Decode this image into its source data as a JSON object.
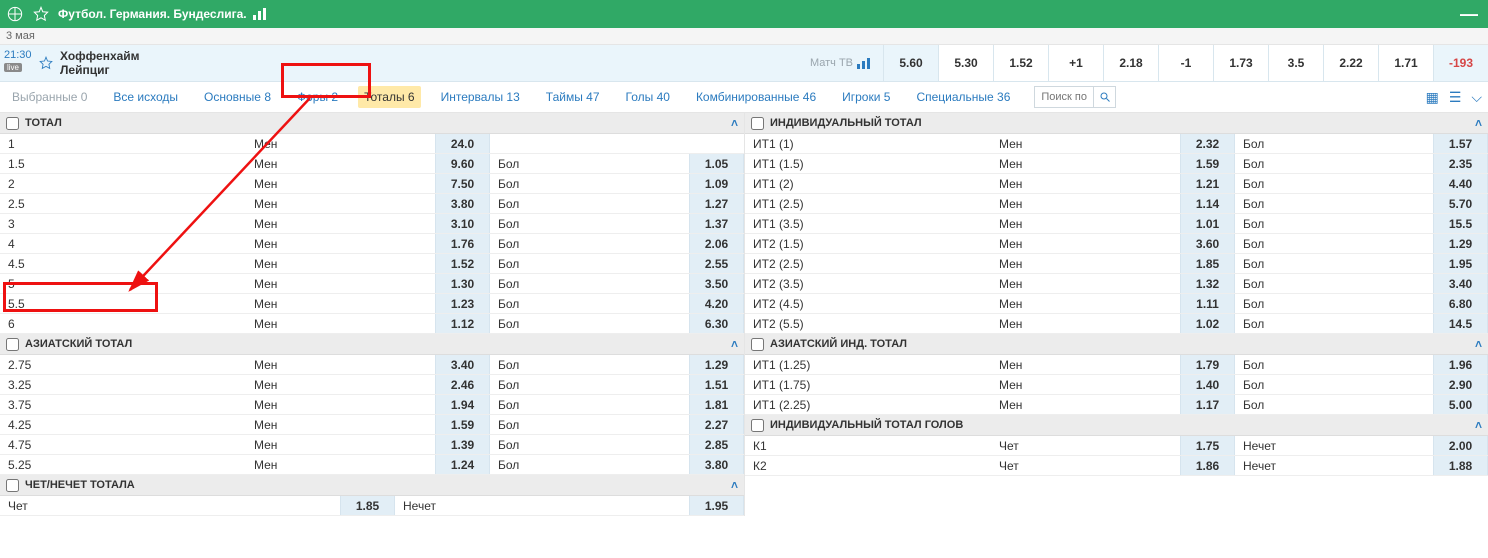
{
  "topbar": {
    "title": "Футбол. Германия. Бундеслига."
  },
  "date": "3 мая",
  "match": {
    "time": "21:30",
    "live": "live",
    "team1": "Хоффенхайм",
    "team2": "Лейпциг",
    "chartlabel": "Матч ТВ",
    "odds": [
      {
        "v": "5.60",
        "hl": true
      },
      {
        "v": "5.30"
      },
      {
        "v": "1.52"
      },
      {
        "v": "+1"
      },
      {
        "v": "2.18"
      },
      {
        "v": "-1"
      },
      {
        "v": "1.73"
      },
      {
        "v": "3.5"
      },
      {
        "v": "2.22"
      },
      {
        "v": "1.71"
      },
      {
        "v": "-193",
        "neg": true,
        "hl": true
      }
    ]
  },
  "tabs": {
    "left": [
      {
        "label": "Выбранные 0",
        "muted": true
      },
      {
        "label": "Все исходы"
      },
      {
        "label": "Основные 8"
      },
      {
        "label": "Форы 2"
      },
      {
        "label": "Тоталы 6",
        "active": true
      },
      {
        "label": "Интервалы 13"
      },
      {
        "label": "Таймы 47"
      },
      {
        "label": "Голы 40"
      },
      {
        "label": "Комбинированные 46"
      },
      {
        "label": "Игроки 5"
      }
    ],
    "right": [
      {
        "label": "Специальные 36"
      }
    ],
    "search_placeholder": "Поиск по"
  },
  "sections": {
    "total": {
      "title": "ТОТАЛ",
      "rows": [
        {
          "l": "1",
          "s1": "Мен",
          "o1": "24.0",
          "s2": "",
          "o2": ""
        },
        {
          "l": "1.5",
          "s1": "Мен",
          "o1": "9.60",
          "s2": "Бол",
          "o2": "1.05"
        },
        {
          "l": "2",
          "s1": "Мен",
          "o1": "7.50",
          "s2": "Бол",
          "o2": "1.09"
        },
        {
          "l": "2.5",
          "s1": "Мен",
          "o1": "3.80",
          "s2": "Бол",
          "o2": "1.27"
        },
        {
          "l": "3",
          "s1": "Мен",
          "o1": "3.10",
          "s2": "Бол",
          "o2": "1.37"
        },
        {
          "l": "4",
          "s1": "Мен",
          "o1": "1.76",
          "s2": "Бол",
          "o2": "2.06"
        },
        {
          "l": "4.5",
          "s1": "Мен",
          "o1": "1.52",
          "s2": "Бол",
          "o2": "2.55"
        },
        {
          "l": "5",
          "s1": "Мен",
          "o1": "1.30",
          "s2": "Бол",
          "o2": "3.50"
        },
        {
          "l": "5.5",
          "s1": "Мен",
          "o1": "1.23",
          "s2": "Бол",
          "o2": "4.20"
        },
        {
          "l": "6",
          "s1": "Мен",
          "o1": "1.12",
          "s2": "Бол",
          "o2": "6.30"
        }
      ]
    },
    "asian_total": {
      "title": "АЗИАТСКИЙ ТОТАЛ",
      "rows": [
        {
          "l": "2.75",
          "s1": "Мен",
          "o1": "3.40",
          "s2": "Бол",
          "o2": "1.29"
        },
        {
          "l": "3.25",
          "s1": "Мен",
          "o1": "2.46",
          "s2": "Бол",
          "o2": "1.51"
        },
        {
          "l": "3.75",
          "s1": "Мен",
          "o1": "1.94",
          "s2": "Бол",
          "o2": "1.81"
        },
        {
          "l": "4.25",
          "s1": "Мен",
          "o1": "1.59",
          "s2": "Бол",
          "o2": "2.27"
        },
        {
          "l": "4.75",
          "s1": "Мен",
          "o1": "1.39",
          "s2": "Бол",
          "o2": "2.85"
        },
        {
          "l": "5.25",
          "s1": "Мен",
          "o1": "1.24",
          "s2": "Бол",
          "o2": "3.80"
        }
      ]
    },
    "even_odd": {
      "title": "ЧЕТ/НЕЧЕТ ТОТАЛА",
      "rows": [
        {
          "l": "Чет",
          "o1": "1.85",
          "s2": "Нечет",
          "o2": "1.95"
        }
      ]
    },
    "ind_total": {
      "title": "ИНДИВИДУАЛЬНЫЙ ТОТАЛ",
      "rows": [
        {
          "l": "ИТ1 (1)",
          "s1": "Мен",
          "o1": "2.32",
          "s2": "Бол",
          "o2": "1.57"
        },
        {
          "l": "ИТ1 (1.5)",
          "s1": "Мен",
          "o1": "1.59",
          "s2": "Бол",
          "o2": "2.35"
        },
        {
          "l": "ИТ1 (2)",
          "s1": "Мен",
          "o1": "1.21",
          "s2": "Бол",
          "o2": "4.40"
        },
        {
          "l": "ИТ1 (2.5)",
          "s1": "Мен",
          "o1": "1.14",
          "s2": "Бол",
          "o2": "5.70"
        },
        {
          "l": "ИТ1 (3.5)",
          "s1": "Мен",
          "o1": "1.01",
          "s2": "Бол",
          "o2": "15.5"
        },
        {
          "l": "ИТ2 (1.5)",
          "s1": "Мен",
          "o1": "3.60",
          "s2": "Бол",
          "o2": "1.29"
        },
        {
          "l": "ИТ2 (2.5)",
          "s1": "Мен",
          "o1": "1.85",
          "s2": "Бол",
          "o2": "1.95"
        },
        {
          "l": "ИТ2 (3.5)",
          "s1": "Мен",
          "o1": "1.32",
          "s2": "Бол",
          "o2": "3.40"
        },
        {
          "l": "ИТ2 (4.5)",
          "s1": "Мен",
          "o1": "1.11",
          "s2": "Бол",
          "o2": "6.80"
        },
        {
          "l": "ИТ2 (5.5)",
          "s1": "Мен",
          "o1": "1.02",
          "s2": "Бол",
          "o2": "14.5"
        }
      ]
    },
    "asian_ind_total": {
      "title": "АЗИАТСКИЙ ИНД. ТОТАЛ",
      "rows": [
        {
          "l": "ИТ1 (1.25)",
          "s1": "Мен",
          "o1": "1.79",
          "s2": "Бол",
          "o2": "1.96"
        },
        {
          "l": "ИТ1 (1.75)",
          "s1": "Мен",
          "o1": "1.40",
          "s2": "Бол",
          "o2": "2.90"
        },
        {
          "l": "ИТ1 (2.25)",
          "s1": "Мен",
          "o1": "1.17",
          "s2": "Бол",
          "o2": "5.00"
        }
      ]
    },
    "ind_total_goals": {
      "title": "ИНДИВИДУАЛЬНЫЙ ТОТАЛ ГОЛОВ",
      "rows": [
        {
          "l": "К1",
          "s1": "Чет",
          "o1": "1.75",
          "s2": "Нечет",
          "o2": "2.00"
        },
        {
          "l": "К2",
          "s1": "Чет",
          "o1": "1.86",
          "s2": "Нечет",
          "o2": "1.88"
        }
      ]
    }
  }
}
